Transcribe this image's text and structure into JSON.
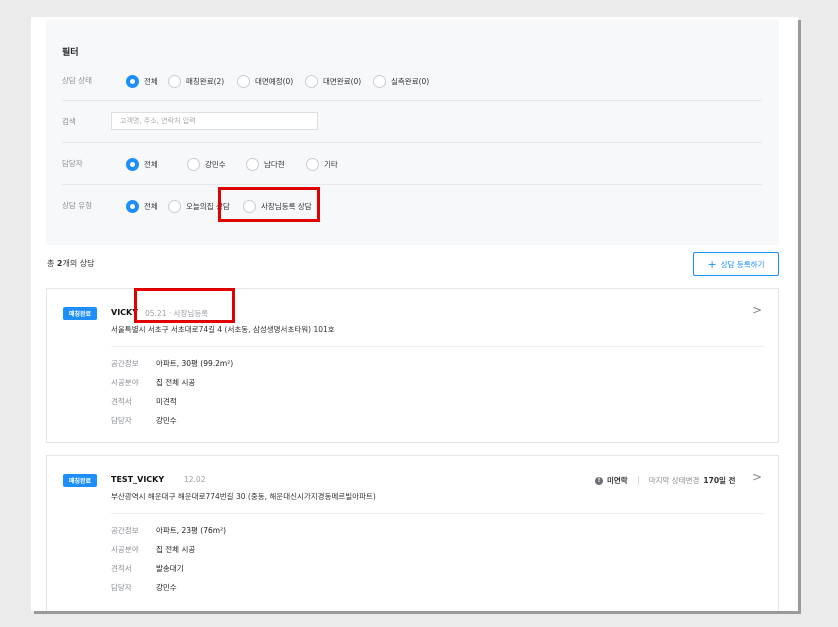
{
  "filter": {
    "title": "필터",
    "status": {
      "label": "상담 상태",
      "options": [
        "전체",
        "매칭완료(2)",
        "대면예정(0)",
        "대면완료(0)",
        "실측완료(0)"
      ],
      "selected": "전체"
    },
    "search": {
      "label": "검색",
      "placeholder": "고객명, 주소, 연락처 입력"
    },
    "manager": {
      "label": "담당자",
      "options": [
        "전체",
        "강민수",
        "남다현",
        "기타"
      ],
      "selected": "전체"
    },
    "type": {
      "label": "상담 유형",
      "options": [
        "전체",
        "오늘의집 상담",
        "사장님등록 상담"
      ],
      "selected": "전체"
    }
  },
  "summary": {
    "prefix": "총 ",
    "count": "2",
    "suffix": "개의 상담"
  },
  "register_button": {
    "plus": "+",
    "label": "상담 등록하기"
  },
  "cards": [
    {
      "badge": "매칭완료",
      "name": "VICKY",
      "date": "05.21 · 사장님등록",
      "address": "서울특별시 서초구 서초대로74길 4 (서초동, 삼성생명서초타워) 101호",
      "info": [
        {
          "key": "공간정보",
          "value": "아파트, 30평 (99.2m²)"
        },
        {
          "key": "시공분야",
          "value": "집 전체 시공"
        },
        {
          "key": "견적서",
          "value": "미견적"
        },
        {
          "key": "담당자",
          "value": "강민수"
        }
      ],
      "chevron": ">"
    },
    {
      "badge": "매칭완료",
      "name": "TEST_VICKY",
      "date": "12.02",
      "address": "부산광역시 해운대구 해운대로774번길 30 (중동, 해운대신시가지경동메르빌아파트)",
      "status_icon": "!",
      "status": "미연락",
      "last_change_label": "마지막 상태변경",
      "last_change_value": "170일 전",
      "info": [
        {
          "key": "공간정보",
          "value": "아파트, 23평 (76m²)"
        },
        {
          "key": "시공분야",
          "value": "집 전체 시공"
        },
        {
          "key": "견적서",
          "value": "발송대기"
        },
        {
          "key": "담당자",
          "value": "강민수"
        }
      ],
      "chevron": ">"
    }
  ],
  "colors": {
    "accent": "#1d8ffd",
    "highlight": "#e00000",
    "background": "#ebebeb",
    "filter_bg": "#f7f8fa"
  }
}
